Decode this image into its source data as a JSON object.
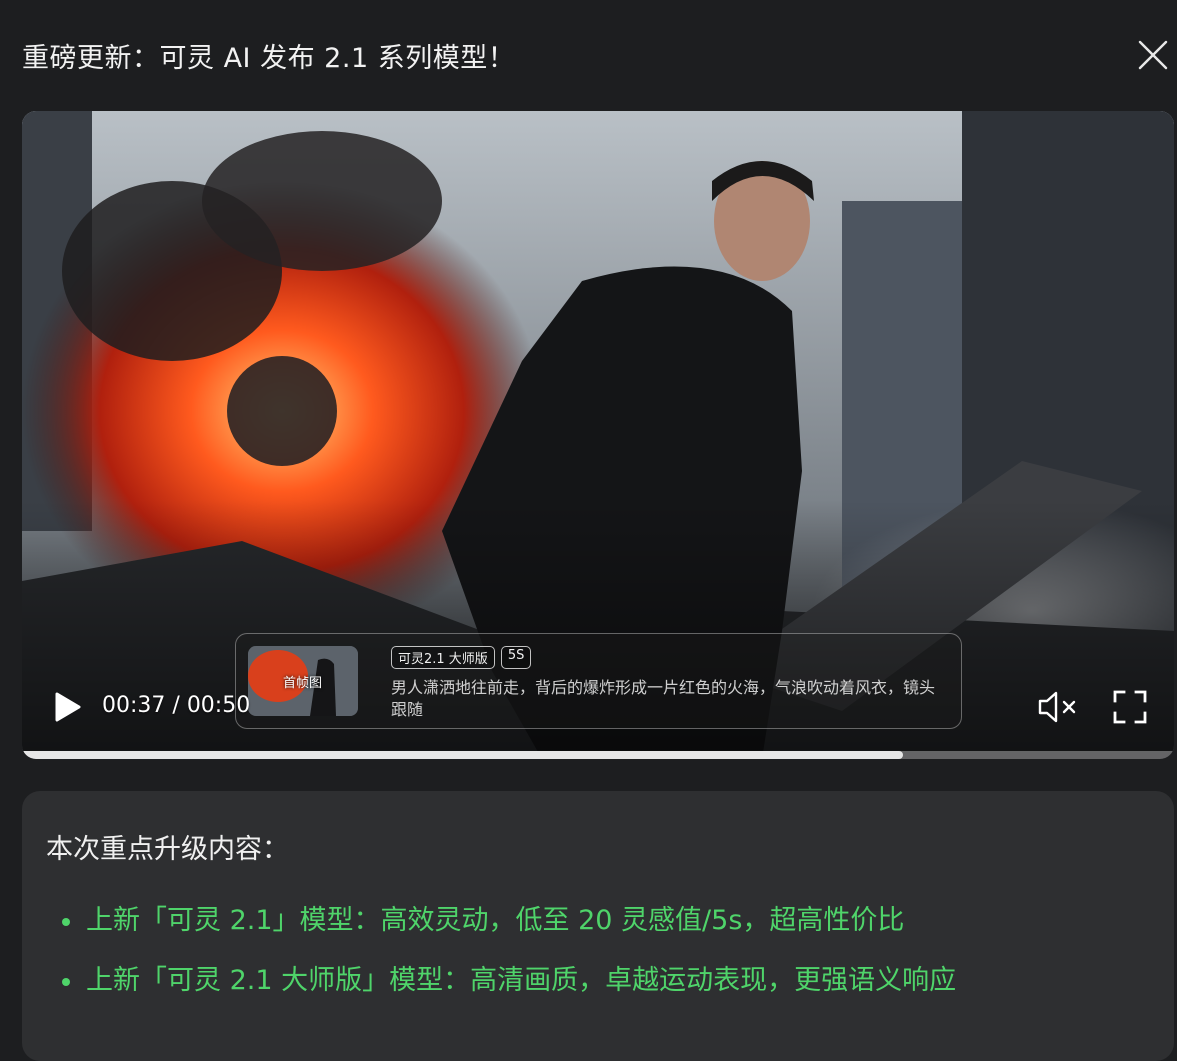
{
  "dialog": {
    "title": "重磅更新：可灵 AI 发布 2.1 系列模型！",
    "close_icon": "close-icon"
  },
  "video": {
    "current_time": "00:37",
    "separator": " / ",
    "duration": "00:50",
    "progress_fraction": 0.765,
    "muted": true,
    "caption_card": {
      "thumb_label": "首帧图",
      "badges": [
        "可灵2.1 大师版",
        "5S"
      ],
      "prompt": "男人潇洒地往前走，背后的爆炸形成一片红色的火海，气浪吹动着风衣，镜头跟随"
    },
    "icons": {
      "play": "play-icon",
      "mute": "volume-muted-icon",
      "fullscreen": "fullscreen-icon"
    }
  },
  "panel": {
    "title": "本次重点升级内容：",
    "items": [
      "上新「可灵 2.1」模型：高效灵动，低至 20 灵感值/5s，超高性价比",
      "上新「可灵 2.1 大师版」模型：高清画质，卓越运动表现，更强语义响应"
    ],
    "accent_color": "#4fd46a"
  }
}
